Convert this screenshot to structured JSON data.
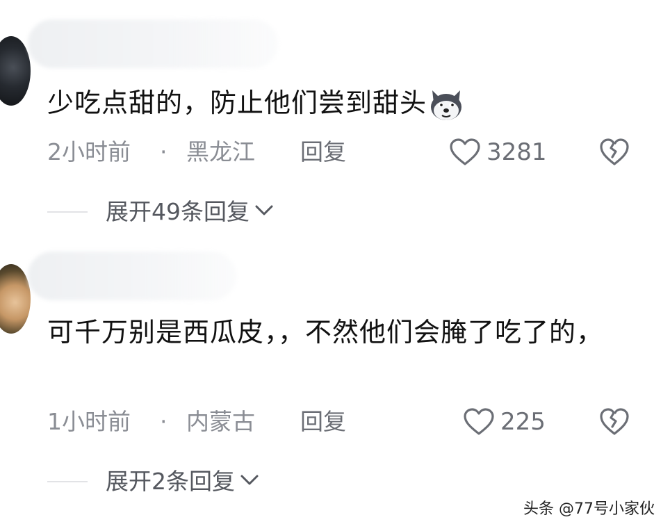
{
  "comments": [
    {
      "text": "少吃点甜的，防止他们尝到甜头",
      "emoji": "husky-dog-emoji-icon",
      "time": "2小时前",
      "separator": "·",
      "location": "黑龙江",
      "reply_label": "回复",
      "likes": "3281",
      "expand_label": "展开49条回复"
    },
    {
      "text": "可千万别是西瓜皮，，不然他们会腌了吃了的，",
      "time": "1小时前",
      "separator": "·",
      "location": "内蒙古",
      "reply_label": "回复",
      "likes": "225",
      "expand_label": "展开2条回复"
    }
  ],
  "watermark": "头条 @77号小家伙",
  "icons": {
    "like": "heart-outline-icon",
    "dislike": "broken-heart-icon",
    "expand": "chevron-down-icon"
  },
  "colors": {
    "text": "#111111",
    "meta": "#8a8d94",
    "icon": "#6b6e75"
  }
}
